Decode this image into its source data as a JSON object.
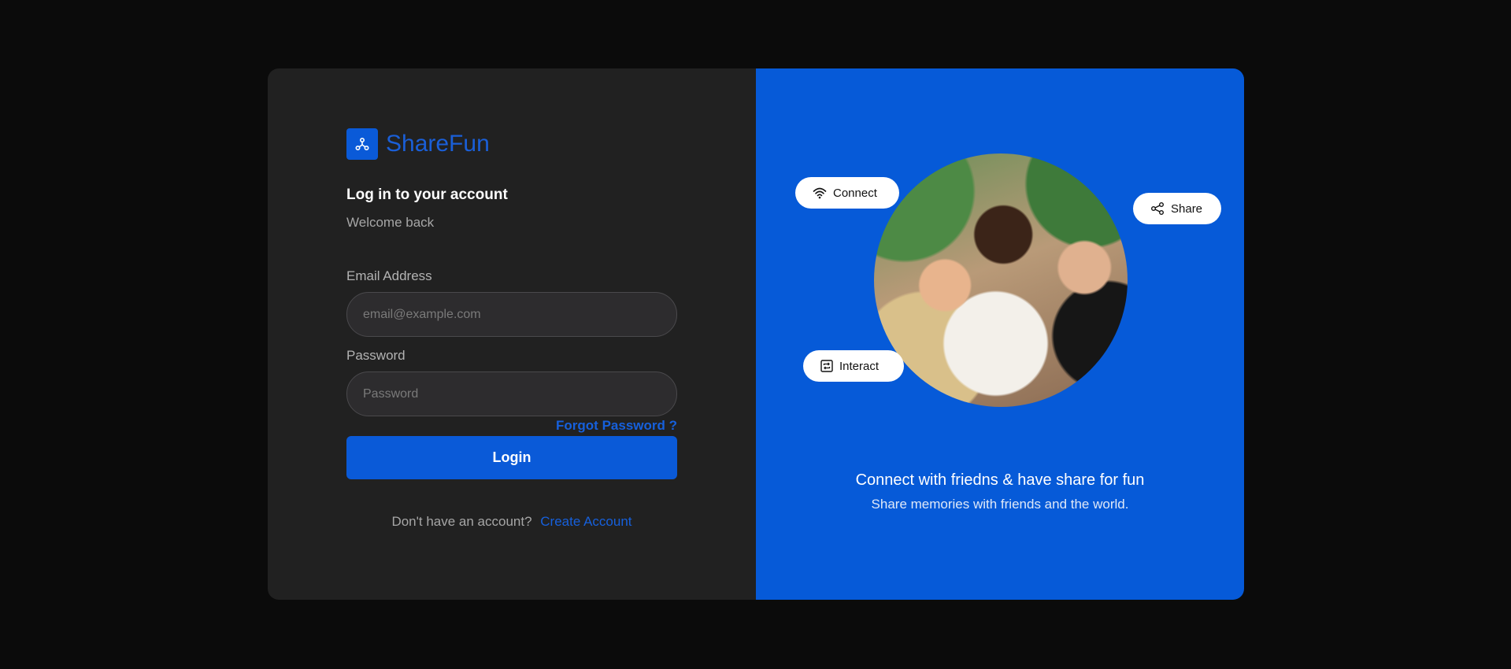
{
  "brand": {
    "name": "ShareFun",
    "logo_icon": "hub-network-icon"
  },
  "login": {
    "heading": "Log in to your account",
    "subheading": "Welcome back",
    "email_label": "Email Address",
    "email_placeholder": "email@example.com",
    "password_label": "Password",
    "password_placeholder": "Password",
    "forgot_label": "Forgot Password ?",
    "login_label": "Login",
    "signup_prompt": "Don't have an account?",
    "create_account_label": "Create Account"
  },
  "hero": {
    "pills": {
      "connect": {
        "label": "Connect",
        "icon": "wifi-icon"
      },
      "share": {
        "label": "Share",
        "icon": "share-icon"
      },
      "interact": {
        "label": "Interact",
        "icon": "repeat-icon"
      }
    },
    "tagline": "Connect with friedns & have share for fun",
    "subtagline": "Share memories with friends and the world."
  },
  "colors": {
    "page_bg": "#0b0b0b",
    "panel_dark": "#212121",
    "accent_blue": "#065ad8",
    "link_blue": "#1660dc",
    "input_bg": "#2d2c2e"
  }
}
